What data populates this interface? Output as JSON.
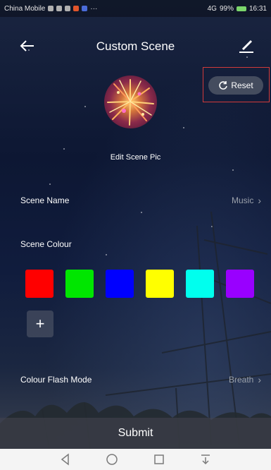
{
  "status_bar": {
    "carrier": "China Mobile",
    "network": "4G",
    "battery": "99%",
    "time": "16:31"
  },
  "header": {
    "title": "Custom Scene",
    "back_icon": "arrow-left-icon",
    "edit_icon": "edit-pen-icon"
  },
  "reset": {
    "label": "Reset",
    "icon": "refresh-icon",
    "highlight_color": "#d23a3a"
  },
  "scene_pic": {
    "caption": "Edit Scene Pic"
  },
  "scene_name": {
    "label": "Scene Name",
    "value": "Music"
  },
  "scene_colour": {
    "label": "Scene Colour",
    "colors": [
      "#ff0000",
      "#00e600",
      "#0000ff",
      "#ffff00",
      "#00ffee",
      "#9900ff"
    ],
    "add_icon": "plus-icon"
  },
  "flash_mode": {
    "label": "Colour Flash Mode",
    "value": "Breath"
  },
  "submit": {
    "label": "Submit"
  },
  "nav_bar": {
    "icons": [
      "back-triangle-icon",
      "home-circle-icon",
      "recents-square-icon",
      "notification-pull-icon"
    ]
  }
}
